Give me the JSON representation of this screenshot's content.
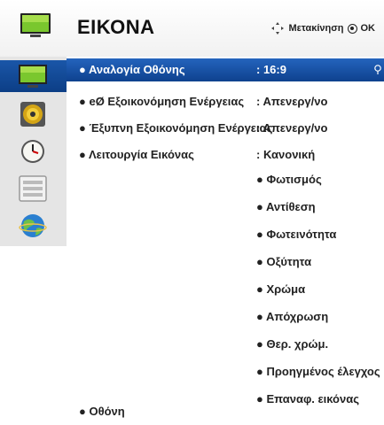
{
  "header": {
    "title": "ΕΙΚΟΝΑ",
    "hint_move": "Μετακίνηση",
    "hint_ok": "OK"
  },
  "sidebar": {
    "items": [
      {
        "icon": "tv-picture-icon",
        "active": true
      },
      {
        "icon": "speaker-icon",
        "active": false
      },
      {
        "icon": "clock-icon",
        "active": false
      },
      {
        "icon": "lock-settings-icon",
        "active": false
      },
      {
        "icon": "globe-icon",
        "active": false
      }
    ]
  },
  "menu": {
    "items": [
      {
        "label": "● Αναλογία Οθόνης",
        "value": ": 16:9"
      },
      {
        "label": "● eØ Εξοικονόμηση Ενέργειας",
        "value": ": Απενεργ/νο"
      },
      {
        "label": "● Έξυπνη Εξοικονόμηση Ενέργειας",
        "value": ": Απενεργ/νο"
      },
      {
        "label": "● Λειτουργία Εικόνας",
        "value": ": Κανονική"
      }
    ],
    "sub_items": [
      "● Φωτισμός",
      "● Αντίθεση",
      "● Φωτεινότητα",
      "● Οξύτητα",
      "● Χρώμα",
      "● Απόχρωση",
      "● Θερ. χρώμ.",
      "● Προηγμένος έλεγχος",
      "● Επαναφ. εικόνας"
    ],
    "last_item": "● Οθόνη"
  },
  "colors": {
    "accent": "#1a56a8",
    "sidebar_bg": "#e5e5e5"
  }
}
